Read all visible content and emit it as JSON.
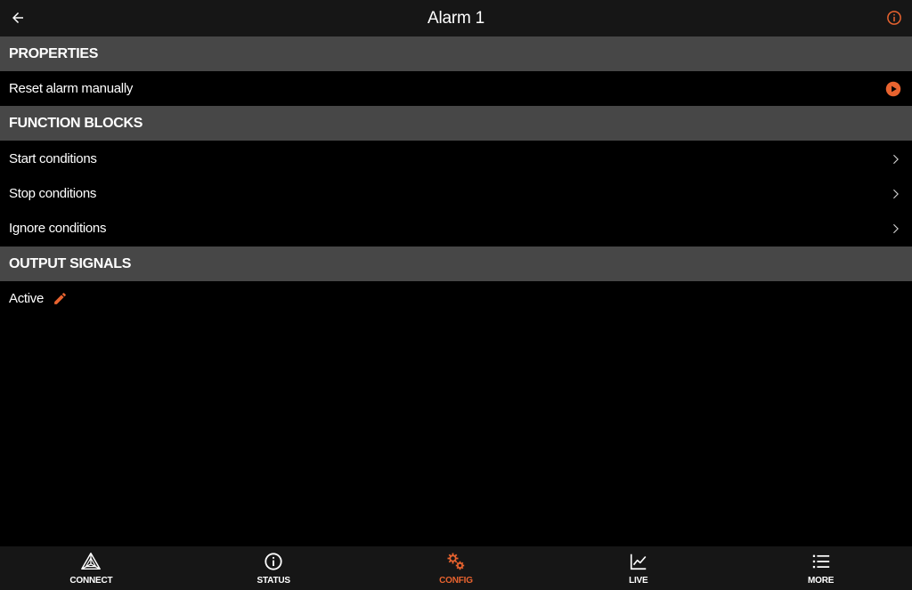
{
  "colors": {
    "accent": "#e8632f",
    "header_bg": "#161616",
    "section_bg": "#474747",
    "background": "#000000"
  },
  "header": {
    "title": "Alarm 1",
    "back_icon": "arrow-left-icon",
    "info_icon": "info-icon"
  },
  "sections": {
    "properties": {
      "title": "PROPERTIES",
      "items": [
        {
          "label": "Reset alarm manually",
          "icon": "play-circle-icon"
        }
      ]
    },
    "function_blocks": {
      "title": "FUNCTION BLOCKS",
      "items": [
        {
          "label": "Start conditions",
          "icon": "chevron-right-icon"
        },
        {
          "label": "Stop conditions",
          "icon": "chevron-right-icon"
        },
        {
          "label": "Ignore conditions",
          "icon": "chevron-right-icon"
        }
      ]
    },
    "output_signals": {
      "title": "OUTPUT SIGNALS",
      "items": [
        {
          "label": "Active",
          "icon": "pencil-icon"
        }
      ]
    }
  },
  "bottom_nav": {
    "items": [
      {
        "label": "CONNECT",
        "icon": "connect-icon",
        "active": false
      },
      {
        "label": "STATUS",
        "icon": "info-circle-icon",
        "active": false
      },
      {
        "label": "CONFIG",
        "icon": "gears-icon",
        "active": true
      },
      {
        "label": "LIVE",
        "icon": "line-chart-icon",
        "active": false
      },
      {
        "label": "MORE",
        "icon": "list-icon",
        "active": false
      }
    ]
  }
}
